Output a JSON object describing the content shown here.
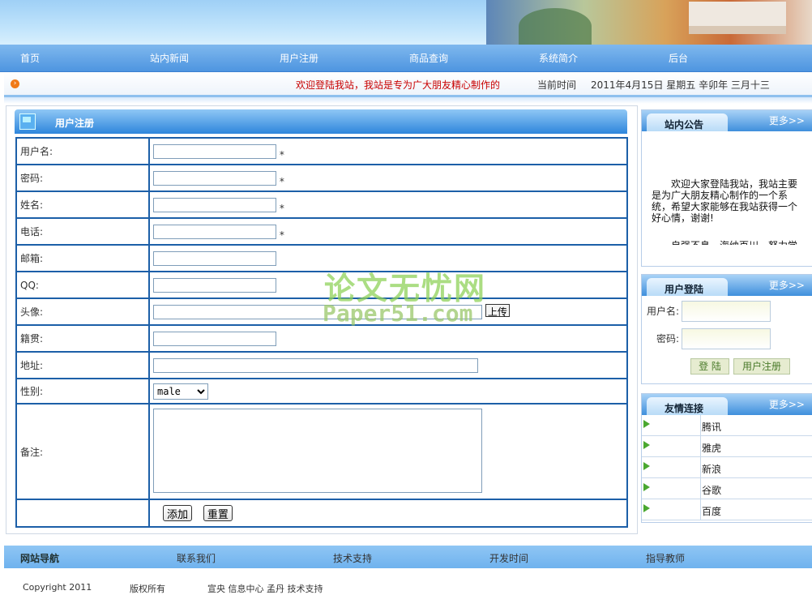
{
  "nav": {
    "items": [
      "首页",
      "站内新闻",
      "用户注册",
      "商品查询",
      "系统简介",
      "后台"
    ]
  },
  "marquee": {
    "text": "欢迎登陆我站，我站是专为广大朋友精心制作的",
    "date_label": "当前时间",
    "date_value": "2011年4月15日  星期五  辛卯年  三月十三"
  },
  "register": {
    "title": "用户注册",
    "required_mark": "*",
    "fields": {
      "username": "用户名:",
      "password": "密码:",
      "realname": "姓名:",
      "phone": "电话:",
      "email": "邮箱:",
      "qq": "QQ:",
      "avatar": "头像:",
      "hometown": "籍贯:",
      "address": "地址:",
      "gender": "性别:",
      "remark": "备注:"
    },
    "upload_button": "上传",
    "gender_value": "male",
    "add_button": "添加",
    "reset_button": "重置"
  },
  "watermark": {
    "line1": "论文无忧网",
    "line2": "Paper51.com"
  },
  "notice_box": {
    "title": "站内公告",
    "more": "更多>>",
    "text": "欢迎大家登陆我站，我站主要是为广大朋友精心制作的一个系统，希望大家能够在我站获得一个好心情，谢谢!",
    "text2": "自强不息，海纳百川，努力学"
  },
  "login_box": {
    "title": "用户登陆",
    "more": "更多>>",
    "username_label": "用户名:",
    "password_label": "密码:",
    "login_button": "登 陆",
    "register_button": "用户注册"
  },
  "links_box": {
    "title": "友情连接",
    "more": "更多>>",
    "links": [
      "腾讯",
      "雅虎",
      "新浪",
      "谷歌",
      "百度"
    ]
  },
  "footer": {
    "title": "网站导航",
    "items": [
      "联系我们",
      "技术支持",
      "开发时间",
      "指导教师"
    ]
  },
  "copyright": {
    "a": "Copyright 2011",
    "b": "版权所有",
    "c": "宣央 信息中心 孟丹 技术支持"
  },
  "colors": {
    "nav_blue": "#4e95e0",
    "form_border": "#1c5fa8",
    "marquee_red": "#c80000"
  }
}
